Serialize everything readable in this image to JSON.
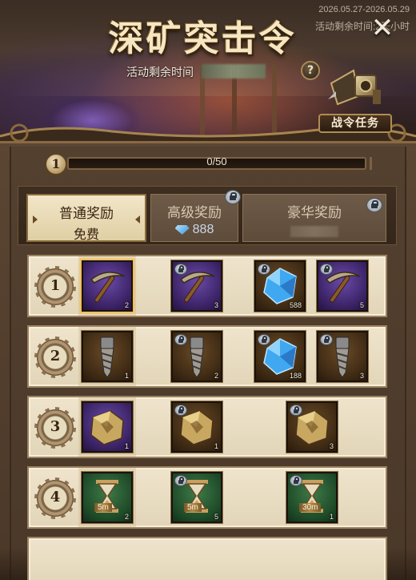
{
  "header": {
    "title": "深矿突击令",
    "dates": "2026.05.27-2026.05.29",
    "remaining_overlay": "活动剩余时间:2天小时",
    "time_label": "活动剩余时间",
    "help_label": "?",
    "close_label": "✕",
    "task_button_label": "战令任务"
  },
  "progress": {
    "level": "1",
    "text": "0/50",
    "fraction": 0.0
  },
  "tabs": [
    {
      "title": "普通奖励",
      "subtitle": "免费",
      "state": "active"
    },
    {
      "title": "高级奖励",
      "price": "888",
      "state": "locked"
    },
    {
      "title": "豪华奖励",
      "state": "locked"
    }
  ],
  "rows": [
    {
      "level": "1",
      "items": [
        {
          "icon": "pickaxe-icon",
          "bg": "purple",
          "qty": "2",
          "locked": false,
          "highlight": true
        },
        {
          "icon": "pickaxe-icon",
          "bg": "purple",
          "qty": "3",
          "locked": true
        },
        {
          "icon": "gem-icon",
          "bg": "brown",
          "qty": "588",
          "locked": true
        },
        {
          "icon": "pickaxe-icon",
          "bg": "purple",
          "qty": "5",
          "locked": true
        }
      ]
    },
    {
      "level": "2",
      "items": [
        {
          "icon": "drill-icon",
          "bg": "brown",
          "qty": "1",
          "locked": false
        },
        {
          "icon": "drill-icon",
          "bg": "brown",
          "qty": "2",
          "locked": true
        },
        {
          "icon": "gem-icon",
          "bg": "brown",
          "qty": "188",
          "locked": true
        },
        {
          "icon": "drill-icon",
          "bg": "brown",
          "qty": "3",
          "locked": true
        }
      ]
    },
    {
      "level": "3",
      "items": [
        {
          "icon": "ore-icon",
          "bg": "purple",
          "qty": "1",
          "locked": false
        },
        {
          "icon": "ore-icon",
          "bg": "brown",
          "qty": "1",
          "locked": true
        },
        {
          "icon": "ore-icon",
          "bg": "brown",
          "qty": "3",
          "locked": true
        }
      ]
    },
    {
      "level": "4",
      "items": [
        {
          "icon": "hourglass-icon",
          "bg": "green",
          "qty": "2",
          "tag": "5m",
          "locked": false
        },
        {
          "icon": "hourglass-icon",
          "bg": "green",
          "qty": "5",
          "tag": "5m",
          "locked": true
        },
        {
          "icon": "hourglass-icon",
          "bg": "green",
          "qty": "1",
          "tag": "30m",
          "locked": true
        }
      ]
    }
  ],
  "colors": {
    "accent_gold": "#b08c52",
    "row_bg": "#efe4cc",
    "panel_bg": "#54402f"
  }
}
